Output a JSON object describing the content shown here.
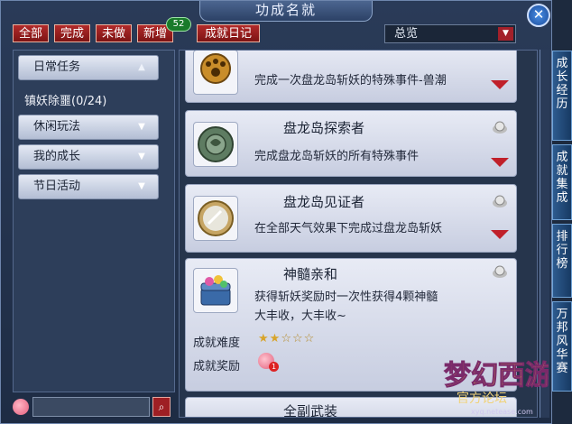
{
  "window": {
    "title": "功成名就"
  },
  "top_buttons": [
    {
      "label": "全部"
    },
    {
      "label": "完成"
    },
    {
      "label": "未做"
    },
    {
      "label": "新增"
    },
    {
      "label": "成就日记"
    }
  ],
  "new_count": "52",
  "overview_select": {
    "value": "总览"
  },
  "sidebar": {
    "items": [
      {
        "label": "日常任务"
      },
      {
        "label": "休闲玩法"
      },
      {
        "label": "我的成长"
      },
      {
        "label": "节日活动"
      }
    ],
    "subitem": "镇妖除噩(0/24)"
  },
  "cards": [
    {
      "desc": "完成一次盘龙岛斩妖的特殊事件-兽潮"
    },
    {
      "title": "盘龙岛探索者",
      "desc": "完成盘龙岛斩妖的所有特殊事件"
    },
    {
      "title": "盘龙岛见证者",
      "desc": "在全部天气效果下完成过盘龙岛斩妖"
    },
    {
      "title": "神髓亲和",
      "desc_line1": "获得斩妖奖励时一次性获得4颗神髓",
      "desc_line2": "大丰收，大丰收~",
      "difficulty_label": "成就难度",
      "difficulty_stars": 2,
      "difficulty_max": 5,
      "reward_label": "成就奖励",
      "reward_count": "1"
    },
    {
      "title": "全副武装"
    }
  ],
  "right_tabs": [
    {
      "label": "成长经历"
    },
    {
      "label": "成就集成"
    },
    {
      "label": "排行榜"
    },
    {
      "label": "万邦风华赛"
    }
  ],
  "logo": {
    "name": "梦幻西游",
    "sub": "官方论坛",
    "url": "xyq.netease.com"
  },
  "colors": {
    "accent_red": "#a3202a",
    "panel_blue": "#2d3e5a",
    "card": "#e8ebf5"
  },
  "icons": [
    "close-icon",
    "search-icon",
    "peach-icon",
    "chevron-down-icon",
    "medal-icon"
  ]
}
